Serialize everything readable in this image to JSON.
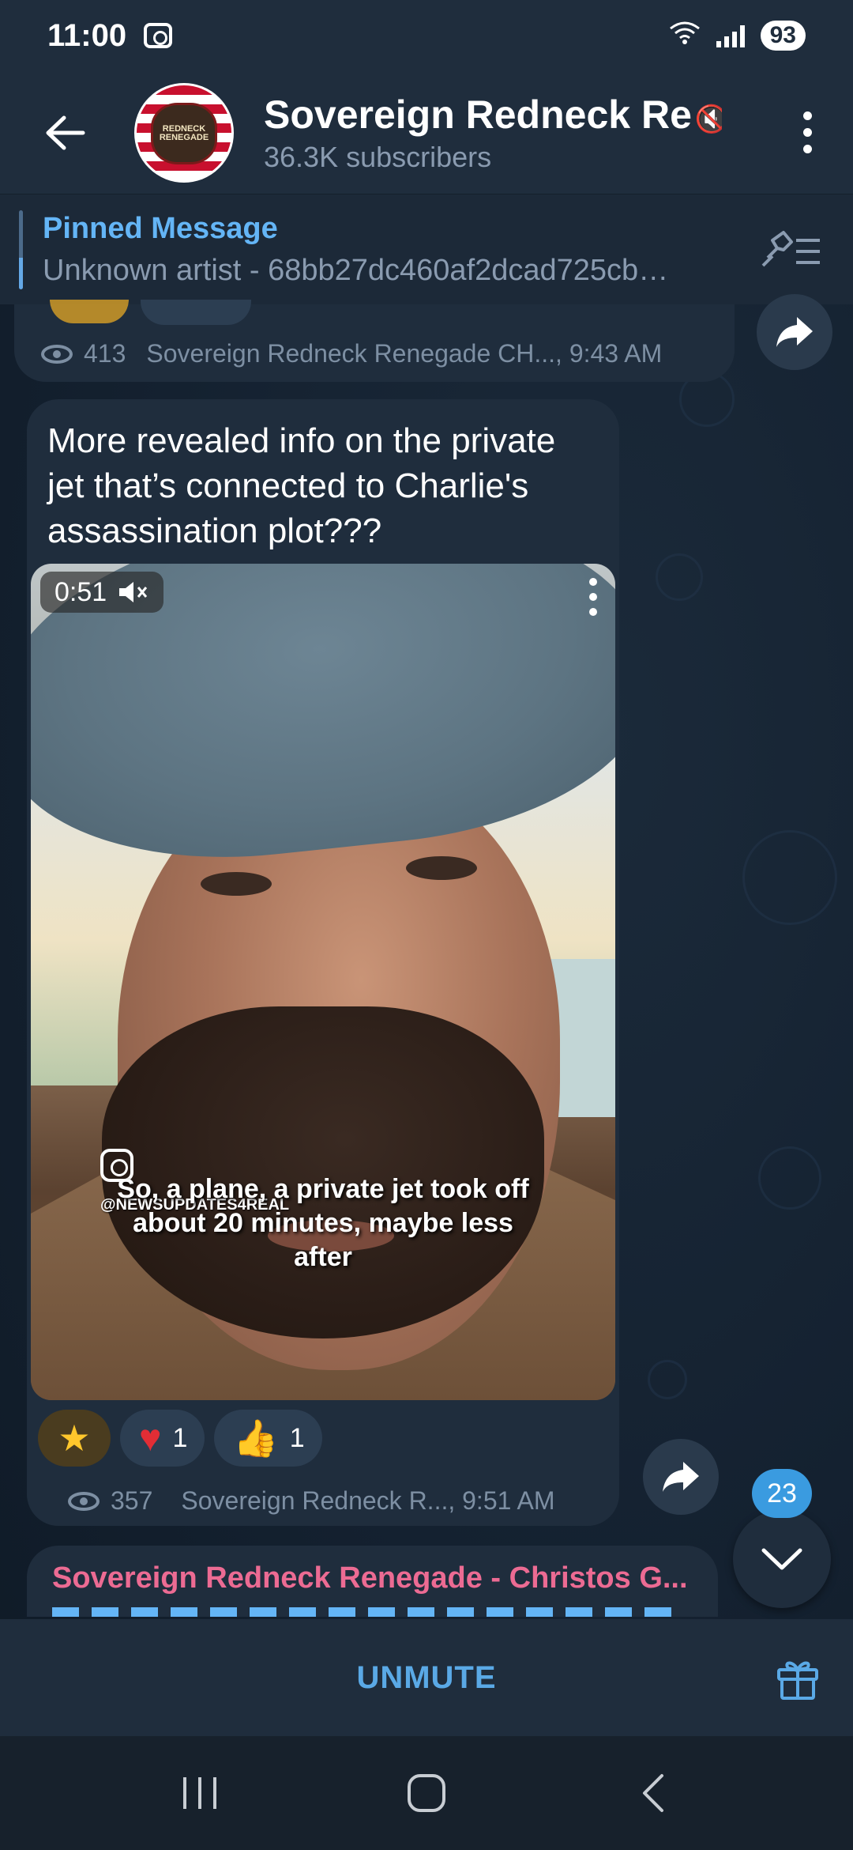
{
  "status_bar": {
    "time": "11:00",
    "battery": "93",
    "wifi_label": "6"
  },
  "header": {
    "channel_name": "Sovereign Redneck Re",
    "subscribers": "36.3K subscribers",
    "avatar_text": "REDNECK RENEGADE"
  },
  "pinned": {
    "title": "Pinned Message",
    "body": "Unknown artist - 68bb27dc460af2dcad725cb…"
  },
  "previous_message": {
    "views": "413",
    "footer": "Sovereign Redneck Renegade CH..., 9:43 AM"
  },
  "message": {
    "text": "More revealed info on the private jet that’s connected to Charlie's assassination plot???",
    "video": {
      "duration": "0:51",
      "watermark": "@NEWSUPDATES4REAL",
      "caption": "So, a plane, a private jet took off about 20 minutes, maybe less after"
    },
    "reactions": [
      {
        "emoji": "star",
        "count": ""
      },
      {
        "emoji": "heart",
        "count": "1"
      },
      {
        "emoji": "thumbs-up",
        "count": "1"
      }
    ],
    "views": "357",
    "footer": "Sovereign Redneck R..., 9:51 AM"
  },
  "next_message": {
    "title": "Sovereign Redneck Renegade - Christos G..."
  },
  "scroll": {
    "unread_count": "23"
  },
  "bottom_bar": {
    "unmute_label": "UNMUTE"
  },
  "colors": {
    "accent": "#5aa9e6",
    "header_bg": "#1f2d3d",
    "bubble_bg": "#1f2d3d",
    "link_pink": "#ec6b93"
  }
}
